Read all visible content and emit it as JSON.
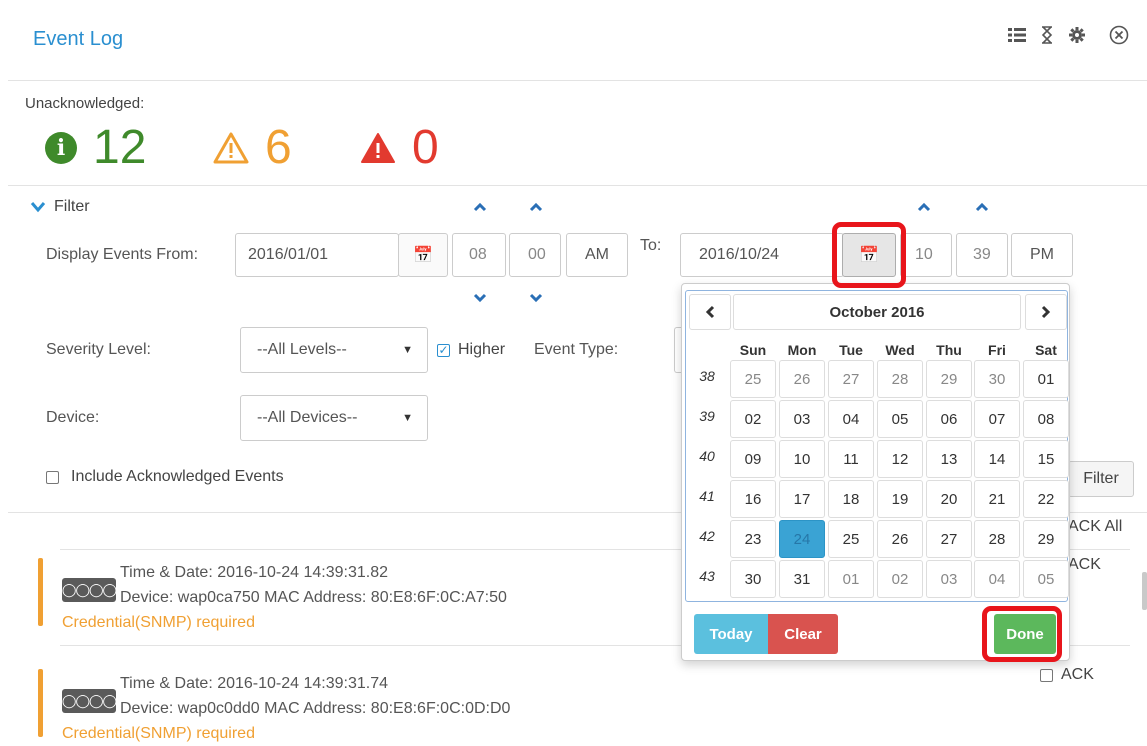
{
  "header": {
    "title": "Event Log",
    "tools": [
      "list-icon",
      "hourglass-icon",
      "gear-icon",
      "close-circle-icon"
    ]
  },
  "unacknowledged": {
    "label": "Unacknowledged:",
    "info_count": "12",
    "warning_count": "6",
    "error_count": "0"
  },
  "filter": {
    "toggle_label": "Filter",
    "from_label": "Display Events From:",
    "from_date": "2016/01/01",
    "from_hour": "08",
    "from_minute": "00",
    "from_ampm": "AM",
    "to_label": "To:",
    "to_date": "2016/10/24",
    "to_hour": "10",
    "to_minute": "39",
    "to_ampm": "PM",
    "severity_label": "Severity Level:",
    "severity_value": "--All Levels--",
    "higher_label": "Higher",
    "event_type_label": "Event Type:",
    "device_label": "Device:",
    "device_value": "--All Devices--",
    "include_ack_label": "Include Acknowledged Events",
    "filter_button": "Filter"
  },
  "ack": {
    "ack_all": "ACK All",
    "ack": "ACK"
  },
  "events": [
    {
      "time": "Time & Date:  2016-10-24 14:39:31.82",
      "device": "Device: wap0ca750  MAC Address: 80:E8:6F:0C:A7:50",
      "message": "Credential(SNMP) required"
    },
    {
      "time": "Time & Date:  2016-10-24 14:39:31.74",
      "device": "Device: wap0c0dd0  MAC Address: 80:E8:6F:0C:0D:D0",
      "message": "Credential(SNMP) required"
    }
  ],
  "calendar": {
    "month": "October 2016",
    "weekdays": [
      "Sun",
      "Mon",
      "Tue",
      "Wed",
      "Thu",
      "Fri",
      "Sat"
    ],
    "weeks": [
      {
        "num": "38",
        "days": [
          "25",
          "26",
          "27",
          "28",
          "29",
          "30",
          "01"
        ]
      },
      {
        "num": "39",
        "days": [
          "02",
          "03",
          "04",
          "05",
          "06",
          "07",
          "08"
        ]
      },
      {
        "num": "40",
        "days": [
          "09",
          "10",
          "11",
          "12",
          "13",
          "14",
          "15"
        ]
      },
      {
        "num": "41",
        "days": [
          "16",
          "17",
          "18",
          "19",
          "20",
          "21",
          "22"
        ]
      },
      {
        "num": "42",
        "days": [
          "23",
          "24",
          "25",
          "26",
          "27",
          "28",
          "29"
        ]
      },
      {
        "num": "43",
        "days": [
          "30",
          "31",
          "01",
          "02",
          "03",
          "04",
          "05"
        ]
      }
    ],
    "selected": "24",
    "today_label": "Today",
    "clear_label": "Clear",
    "done_label": "Done"
  },
  "colors": {
    "accent": "#2a8fd0",
    "info": "#3f8a2b",
    "warning": "#f0a033",
    "error": "#e23a2f",
    "highlight": "#e8151b"
  }
}
